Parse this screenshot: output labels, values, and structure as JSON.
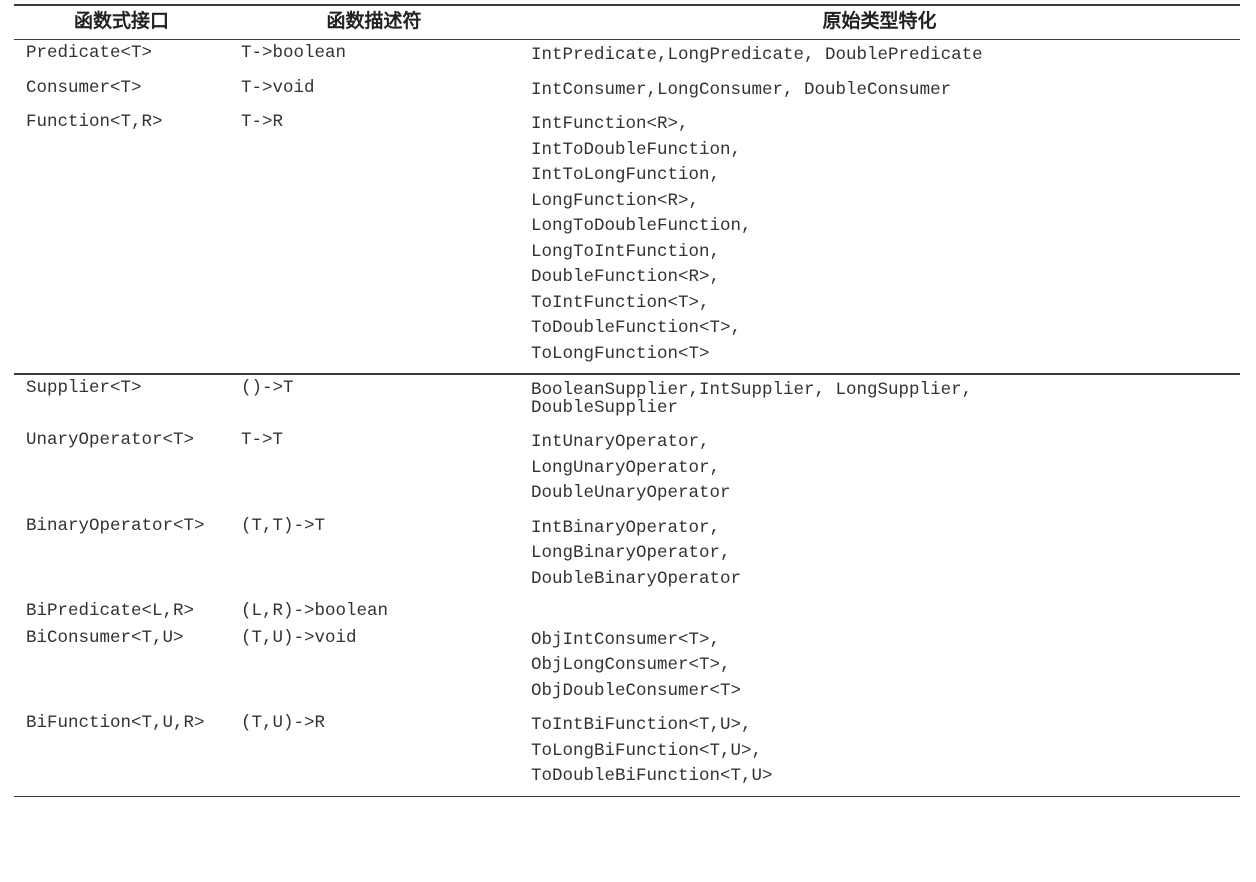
{
  "headers": {
    "col1": "函数式接口",
    "col2": "函数描述符",
    "col3": "原始类型特化"
  },
  "rows": [
    {
      "iface": "Predicate<T>",
      "desc": "T->boolean",
      "spec": [
        "IntPredicate,LongPredicate, DoublePredicate"
      ]
    },
    {
      "iface": "Consumer<T>",
      "desc": "T->void",
      "spec": [
        "IntConsumer,LongConsumer, DoubleConsumer"
      ]
    },
    {
      "iface": "Function<T,R>",
      "desc": "T->R",
      "spec": [
        "IntFunction<R>,",
        "IntToDoubleFunction,",
        "IntToLongFunction,",
        "LongFunction<R>,",
        "LongToDoubleFunction,",
        "LongToIntFunction,",
        "DoubleFunction<R>,",
        "ToIntFunction<T>,",
        "ToDoubleFunction<T>,",
        "ToLongFunction<T>"
      ]
    },
    {
      "sep": true,
      "iface": "Supplier<T>",
      "desc": "()->T",
      "spec": [
        "BooleanSupplier,IntSupplier, LongSupplier,\nDoubleSupplier"
      ]
    },
    {
      "iface": "UnaryOperator<T>",
      "desc": "T->T",
      "spec": [
        "IntUnaryOperator,",
        "LongUnaryOperator,",
        "DoubleUnaryOperator"
      ]
    },
    {
      "iface": "BinaryOperator<T>",
      "desc": "(T,T)->T",
      "spec": [
        "IntBinaryOperator,",
        "LongBinaryOperator,",
        "DoubleBinaryOperator"
      ]
    },
    {
      "iface": "BiPredicate<L,R>",
      "desc": "(L,R)->boolean",
      "spec": [
        ""
      ]
    },
    {
      "iface": "BiConsumer<T,U>",
      "desc": "(T,U)->void",
      "spec": [
        "ObjIntConsumer<T>,",
        "ObjLongConsumer<T>,",
        "ObjDoubleConsumer<T>"
      ]
    },
    {
      "last": true,
      "iface": "BiFunction<T,U,R>",
      "desc": "(T,U)->R",
      "spec": [
        "ToIntBiFunction<T,U>,",
        "ToLongBiFunction<T,U>,",
        "ToDoubleBiFunction<T,U>"
      ]
    }
  ]
}
